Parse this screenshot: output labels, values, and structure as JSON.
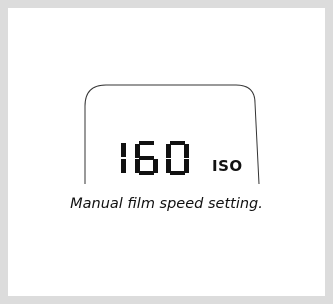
{
  "display": {
    "value": "160",
    "unit": "ISO"
  },
  "caption": "Manual film speed setting."
}
